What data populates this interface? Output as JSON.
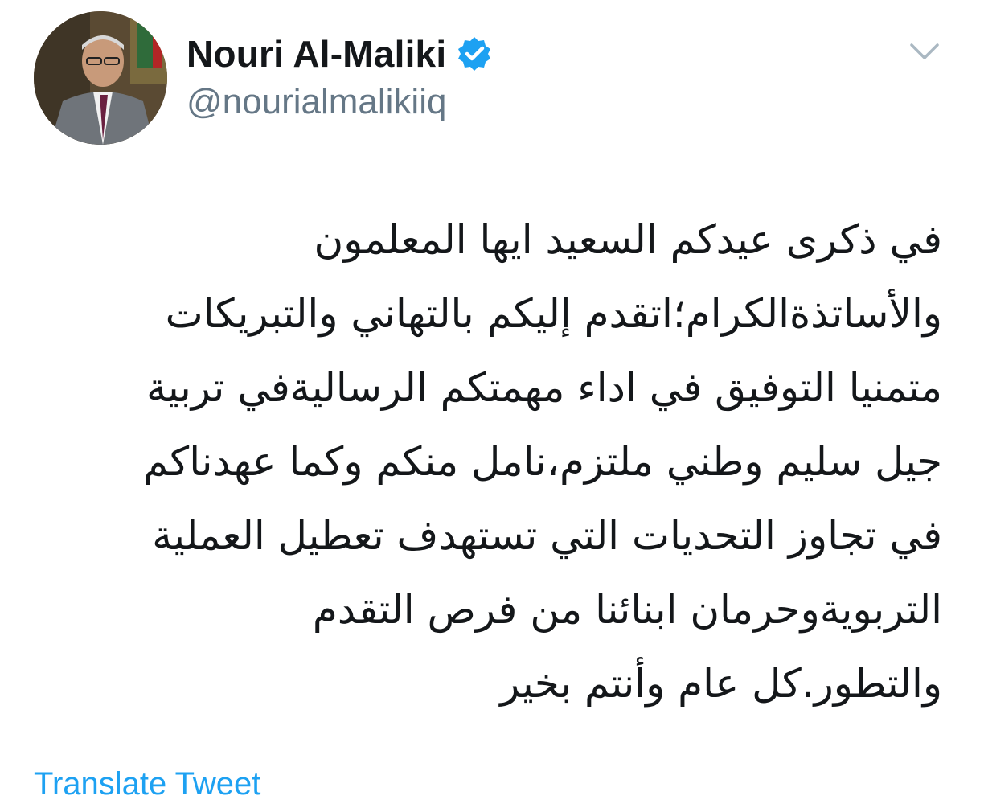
{
  "author": {
    "display_name": "Nouri Al-Maliki",
    "handle": "@nourialmalikiiq",
    "verified": true,
    "verified_icon": "verified-badge-icon",
    "avatar_icon": "profile-photo"
  },
  "menu": {
    "icon": "chevron-down-icon"
  },
  "tweet": {
    "lines": [
      "في ذكرى عيدكم السعيد ايها المعلمون",
      "والأساتذةالكرام؛اتقدم إليكم بالتهاني والتبريكات",
      "متمنيا التوفيق في اداء مهمتكم الرساليةفي تربية",
      "جيل سليم وطني ملتزم،نامل منكم وكما عهدناكم",
      "في تجاوز التحديات التي تستهدف تعطيل العملية",
      "التربويةوحرمان ابنائنا من فرص التقدم",
      "والتطور.كل عام وأنتم بخير"
    ]
  },
  "translate": {
    "label": "Translate Tweet"
  },
  "colors": {
    "verified": "#1da1f2",
    "link": "#1da1f2",
    "handle": "#657786",
    "chevron": "#aab8c2"
  }
}
